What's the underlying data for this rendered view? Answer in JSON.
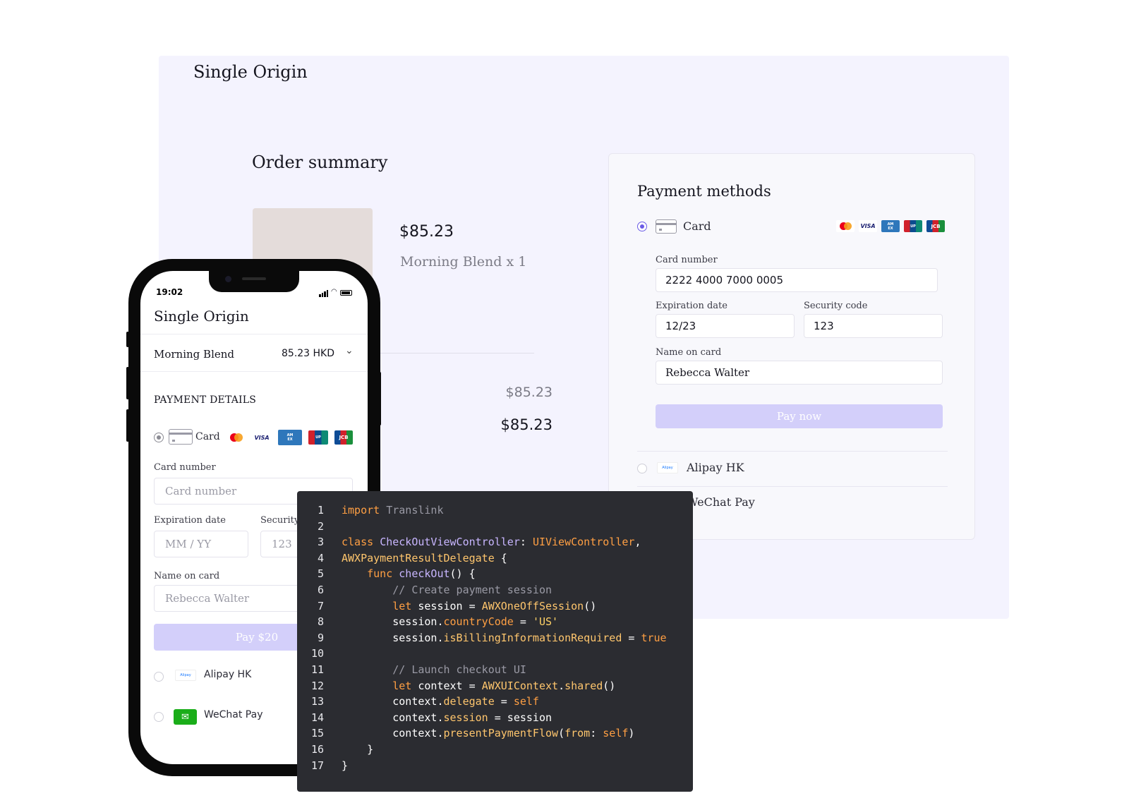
{
  "web": {
    "brand": "Single Origin",
    "order_summary_title": "Order summary",
    "product": {
      "price": "$85.23",
      "name": "Morning Blend x 1"
    },
    "subtotal": "$85.23",
    "total": "$85.23",
    "payment": {
      "title": "Payment methods",
      "card_label": "Card",
      "brands": [
        "Mastercard",
        "VISA",
        "American Express",
        "UnionPay",
        "JCB"
      ],
      "card_number_label": "Card number",
      "card_number_value": "2222 4000 7000 0005",
      "expiry_label": "Expiration date",
      "expiry_value": "12/23",
      "cvc_label": "Security code",
      "cvc_value": "123",
      "name_label": "Name on card",
      "name_value": "Rebecca Walter",
      "pay_button": "Pay now",
      "alipay_label": "Alipay HK",
      "alipay_logo_text": "Alipay",
      "wechat_label": "WeChat Pay"
    }
  },
  "phone": {
    "time": "19:02",
    "brand": "Single Origin",
    "product_name": "Morning Blend",
    "product_price": "85.23 HKD",
    "section_title": "PAYMENT DETAILS",
    "card_label": "Card",
    "card_number_label": "Card number",
    "card_number_placeholder": "Card number",
    "expiry_label": "Expiration date",
    "expiry_placeholder": "MM / YY",
    "cvc_label": "Security code",
    "cvc_placeholder": "123",
    "name_label": "Name on card",
    "name_placeholder": "Rebecca Walter",
    "pay_button": "Pay $20",
    "alipay_label": "Alipay HK",
    "alipay_logo_text": "Alipay",
    "wechat_label": "WeChat Pay"
  },
  "code": {
    "lines": [
      "import Translink",
      "",
      "class CheckOutViewController: UIViewController,",
      "AWXPaymentResultDelegate {",
      "    func checkOut() {",
      "        // Create payment session",
      "        let session = AWXOneOffSession()",
      "        session.countryCode = 'US'",
      "        session.isBillingInformationRequired = true",
      "",
      "        // Launch checkout UI",
      "        let context = AWXUIContext.shared()",
      "        context.delegate = self",
      "        context.session = session",
      "        context.presentPaymentFlow(from: self)",
      "    }",
      "}"
    ]
  },
  "colors": {
    "accent": "#6a5be6",
    "pay_button": "#d3cffa",
    "web_background": "#f4f3fe",
    "code_background": "#2b2c31",
    "keyword": "#ff9f43"
  },
  "icons": [
    "card-icon",
    "mastercard-icon",
    "visa-icon",
    "amex-icon",
    "unionpay-icon",
    "jcb-icon",
    "alipay-icon",
    "wechat-icon",
    "chevron-down-icon",
    "signal-icon",
    "wifi-icon",
    "battery-icon"
  ]
}
